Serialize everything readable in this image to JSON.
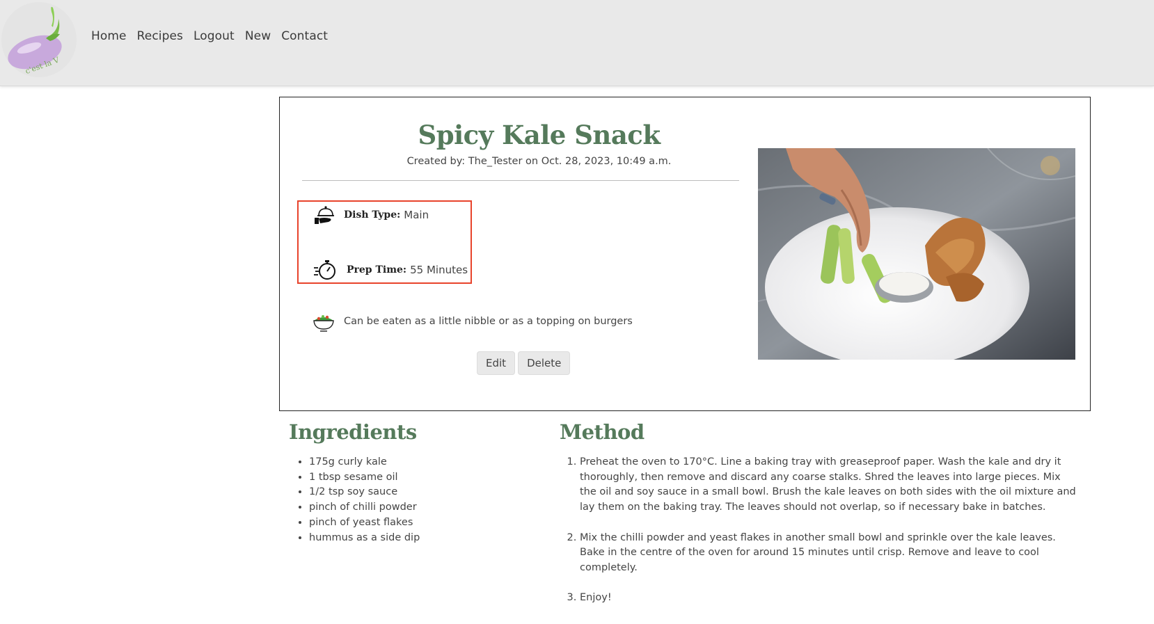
{
  "header": {
    "logo_alt": "eggplant logo",
    "nav": [
      "Home",
      "Recipes",
      "Logout",
      "New",
      "Contact"
    ]
  },
  "recipe": {
    "title": "Spicy Kale Snack",
    "created": "Created by: The_Tester on Oct. 28, 2023, 10:49 a.m.",
    "dish_type_label": "Dish Type:",
    "dish_type_value": "Main",
    "prep_time_label": "Prep Time:",
    "prep_time_value": "55 Minutes",
    "summary": "Can be eaten as a little nibble or as a topping on burgers",
    "edit_label": "Edit",
    "delete_label": "Delete",
    "image_alt": "hand dipping celery into a dip bowl on a plate with wings"
  },
  "ingredients": {
    "title": "Ingredients",
    "items": [
      "175g curly kale",
      "1 tbsp sesame oil",
      "1/2 tsp soy sauce",
      "pinch of chilli powder",
      "pinch of yeast flakes",
      "hummus as a side dip"
    ]
  },
  "method": {
    "title": "Method",
    "steps": [
      "Preheat the oven to 170°C. Line a baking tray with greaseproof paper. Wash the kale and dry it thoroughly, then remove and discard any coarse stalks. Shred the leaves into large pieces. Mix the oil and soy sauce in a small bowl. Brush the kale leaves on both sides with the oil mixture and lay them on the baking tray. The leaves should not overlap, so if necessary bake in batches.",
      "Mix the chilli powder and yeast flakes in another small bowl and sprinkle over the kale leaves. Bake in the centre of the oven for around 15 minutes until crisp. Remove and leave to cool completely.",
      "Enjoy!"
    ]
  },
  "colors": {
    "accent_green": "#557a5b",
    "highlight_red": "#e8432b",
    "header_bg": "#e9e9e9"
  }
}
